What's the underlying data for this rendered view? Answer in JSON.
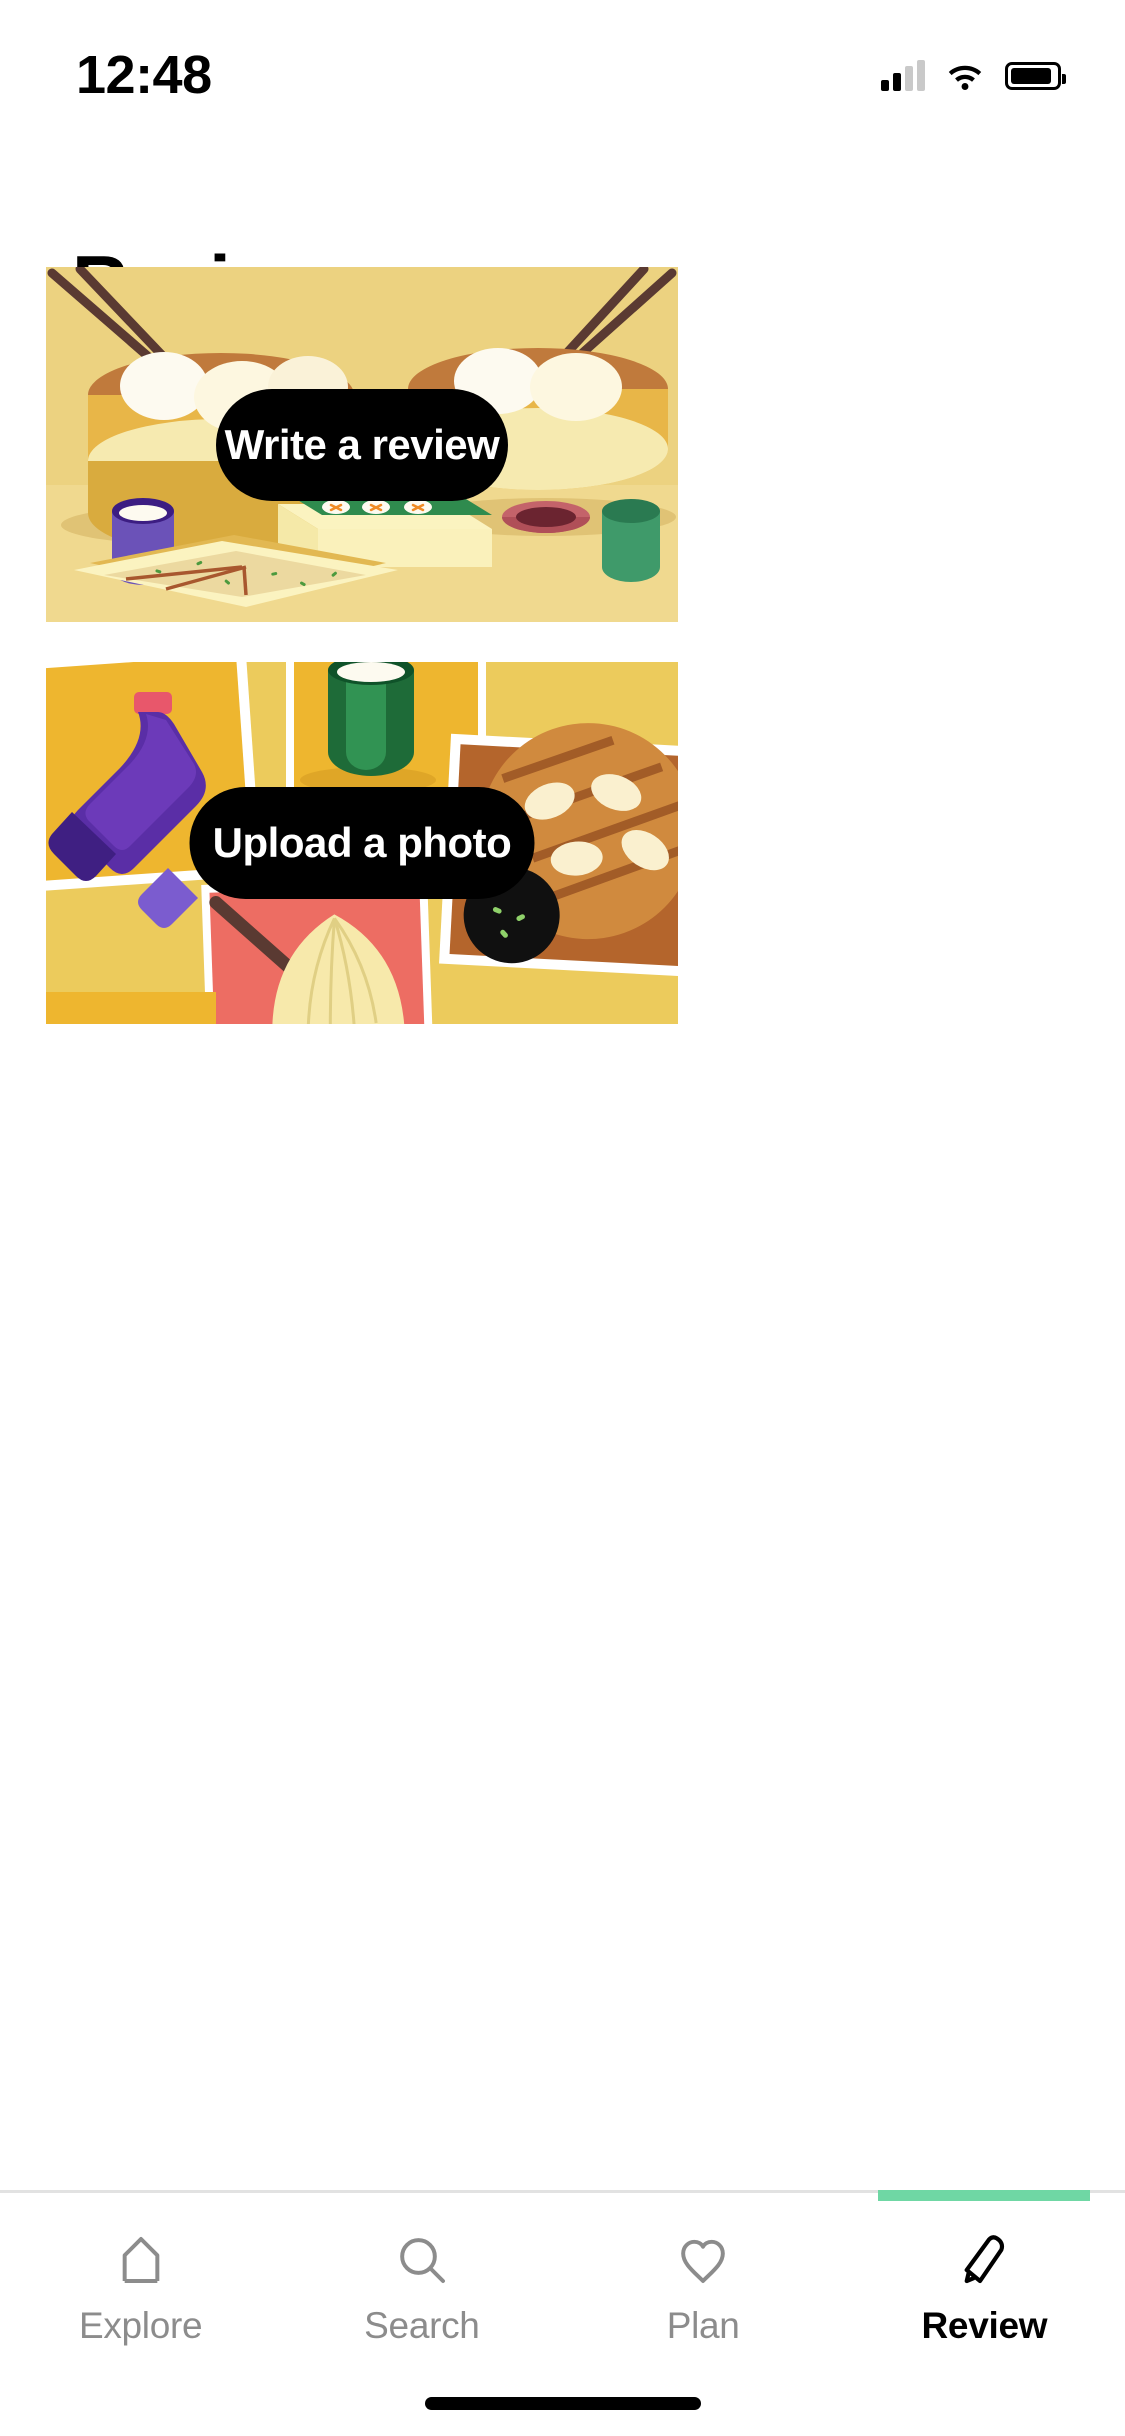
{
  "status_bar": {
    "time": "12:48",
    "icons": [
      "cellular-signal-icon",
      "wifi-icon",
      "battery-icon"
    ]
  },
  "header": {
    "title": "Review"
  },
  "cards": [
    {
      "id": "write-a-review",
      "cta_label": "Write a review",
      "illustration": "dim-sum-table-illustration",
      "background": "#ECD280"
    },
    {
      "id": "upload-a-photo",
      "cta_label": "Upload a photo",
      "illustration": "food-photo-collage-illustration",
      "background": "#ECCB5C"
    }
  ],
  "tabbar": {
    "active_accent_color": "#6FD7A4",
    "items": [
      {
        "label": "Explore",
        "icon": "home-icon",
        "active": false
      },
      {
        "label": "Search",
        "icon": "search-icon",
        "active": false
      },
      {
        "label": "Plan",
        "icon": "heart-icon",
        "active": false
      },
      {
        "label": "Review",
        "icon": "pencil-icon",
        "active": true
      }
    ]
  }
}
